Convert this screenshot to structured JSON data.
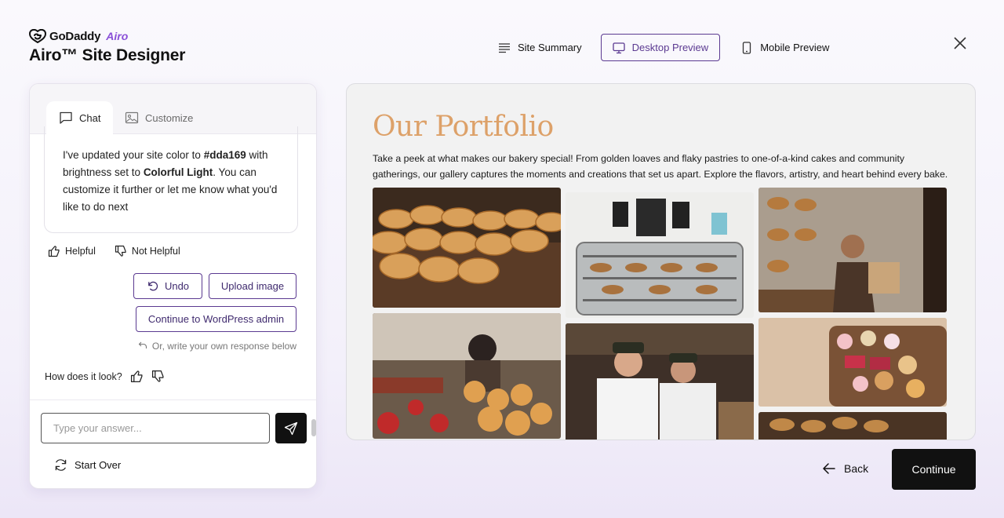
{
  "brand": {
    "company": "GoDaddy",
    "product": "Airo",
    "title": "Airo™ Site Designer"
  },
  "topnav": {
    "site_summary": "Site Summary",
    "desktop_preview": "Desktop Preview",
    "mobile_preview": "Mobile Preview"
  },
  "tabs": {
    "chat": "Chat",
    "customize": "Customize"
  },
  "chat": {
    "message_part1": "I've updated your site color to ",
    "color_value": "#dda169",
    "message_part2": " with brightness set to ",
    "brightness_value": "Colorful Light",
    "message_part3": ". You can customize it further or let me know what you'd like to do next",
    "helpful": "Helpful",
    "not_helpful": "Not Helpful",
    "undo": "Undo",
    "upload_image": "Upload image",
    "continue_wp": "Continue to WordPress admin",
    "hint": "Or, write your own response below",
    "how_look": "How does it look?"
  },
  "compose": {
    "placeholder": "Type your answer...",
    "start_over": "Start Over"
  },
  "preview": {
    "title": "Our Portfolio",
    "description": "Take a peek at what makes our bakery special! From golden loaves and flaky pastries to one-of-a-kind cakes and community gatherings, our gallery captures the moments and creations that set us apart. Explore the flavors, artistry, and heart behind every bake.",
    "accent_color": "#dda169"
  },
  "footer": {
    "back": "Back",
    "continue": "Continue"
  }
}
